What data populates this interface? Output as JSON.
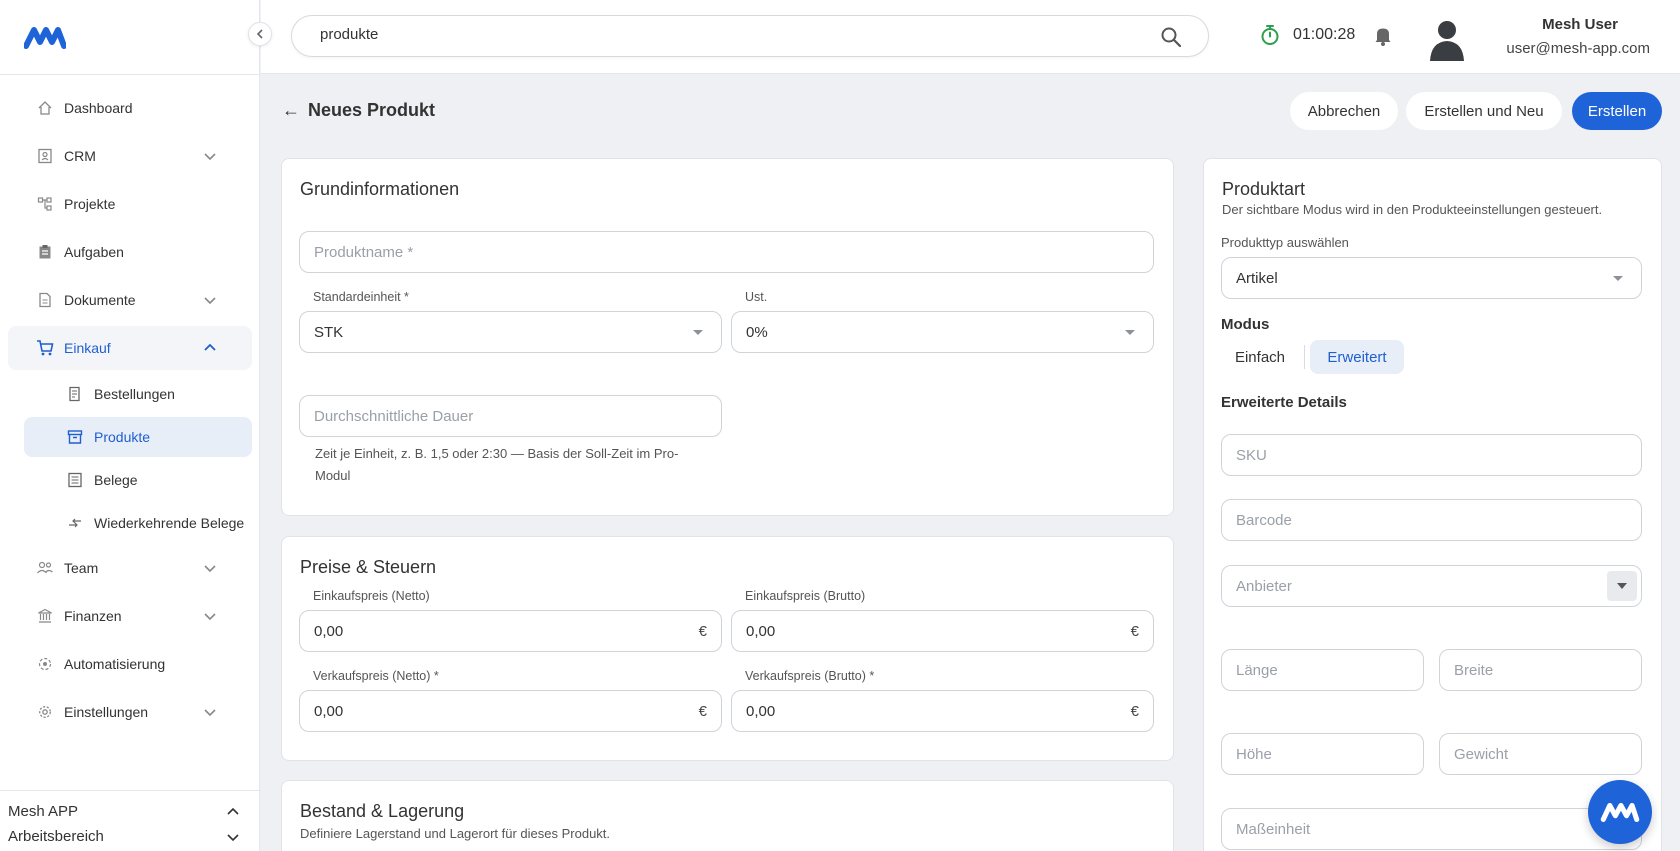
{
  "search": {
    "value": "produkte"
  },
  "timer": "01:00:28",
  "user": {
    "name": "Mesh User",
    "email": "user@mesh-app.com"
  },
  "nav": {
    "dashboard": "Dashboard",
    "crm": "CRM",
    "projekte": "Projekte",
    "aufgaben": "Aufgaben",
    "dokumente": "Dokumente",
    "einkauf": "Einkauf",
    "bestellungen": "Bestellungen",
    "produkte": "Produkte",
    "belege": "Belege",
    "wiederkehrende": "Wiederkehrende Belege",
    "team": "Team",
    "finanzen": "Finanzen",
    "automatisierung": "Automatisierung",
    "einstellungen": "Einstellungen"
  },
  "workspace": {
    "app": "Mesh APP",
    "bereich": "Arbeitsbereich"
  },
  "page": {
    "title": "Neues Produkt"
  },
  "actions": {
    "cancel": "Abbrechen",
    "create_new": "Erstellen und Neu",
    "create": "Erstellen"
  },
  "grund": {
    "title": "Grundinformationen",
    "produktname_ph": "Produktname *",
    "einheit_label": "Standardeinheit *",
    "einheit_value": "STK",
    "ust_label": "Ust.",
    "ust_value": "0%",
    "dauer_ph": "Durchschnittliche Dauer",
    "dauer_help_1": "Zeit je Einheit, z. B. 1,5 oder 2:30 — Basis der Soll-Zeit im Pro-",
    "dauer_help_2": "Modul"
  },
  "preise": {
    "title": "Preise & Steuern",
    "ek_netto_label": "Einkaufspreis (Netto)",
    "ek_brutto_label": "Einkaufspreis (Brutto)",
    "vk_netto_label": "Verkaufspreis (Netto) *",
    "vk_brutto_label": "Verkaufspreis (Brutto) *",
    "ek_netto": "0,00",
    "ek_brutto": "0,00",
    "vk_netto": "0,00",
    "vk_brutto": "0,00",
    "currency": "€"
  },
  "bestand": {
    "title": "Bestand & Lagerung",
    "sub": "Definiere Lagerstand und Lagerort für dieses Produkt."
  },
  "produktart": {
    "title": "Produktart",
    "sub": "Der sichtbare Modus wird in den Produkteeinstellungen gesteuert.",
    "typ_label": "Produkttyp auswählen",
    "typ_value": "Artikel",
    "modus_label": "Modus",
    "mode_simple": "Einfach",
    "mode_advanced": "Erweitert",
    "details_label": "Erweiterte Details",
    "sku_ph": "SKU",
    "barcode_ph": "Barcode",
    "anbieter_ph": "Anbieter",
    "laenge_ph": "Länge",
    "breite_ph": "Breite",
    "hoehe_ph": "Höhe",
    "gewicht_ph": "Gewicht",
    "masseinheit_ph": "Maßeinheit"
  },
  "colors": {
    "primary": "#1f63d8",
    "timer": "#2e9e4f"
  }
}
